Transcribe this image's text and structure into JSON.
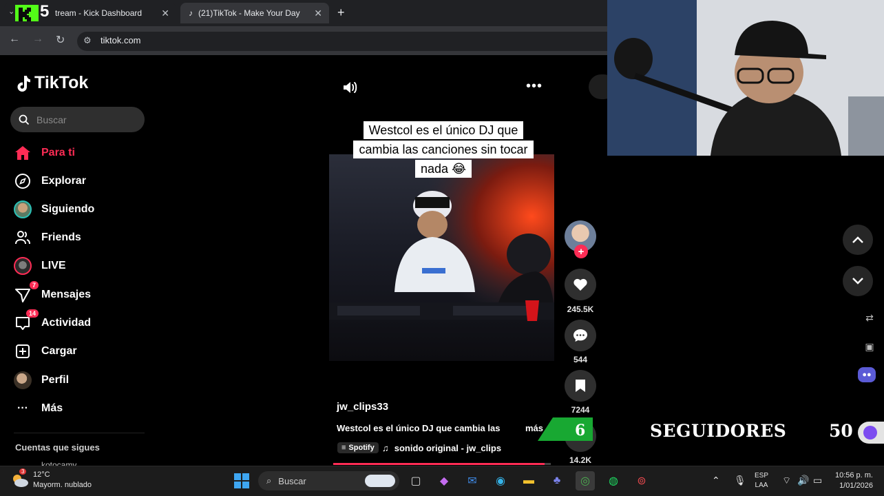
{
  "browser": {
    "tabs": [
      {
        "label": "tream - Kick Dashboard",
        "active": false
      },
      {
        "label": "(21)TikTok - Make Your Day",
        "active": true
      }
    ],
    "kick_badge": "5",
    "url": "tiktok.com"
  },
  "tiktok": {
    "brand": "TikTok",
    "search_placeholder": "Buscar",
    "nav": [
      {
        "label": "Para ti",
        "icon": "home-icon",
        "active": true
      },
      {
        "label": "Explorar",
        "icon": "compass-icon"
      },
      {
        "label": "Siguiendo",
        "icon": "following-avatar"
      },
      {
        "label": "Friends",
        "icon": "friends-icon"
      },
      {
        "label": "LIVE",
        "icon": "live-avatar"
      },
      {
        "label": "Mensajes",
        "icon": "messages-icon",
        "badge": "7"
      },
      {
        "label": "Actividad",
        "icon": "activity-icon",
        "badge": "14"
      },
      {
        "label": "Cargar",
        "icon": "upload-icon"
      },
      {
        "label": "Perfil",
        "icon": "profile-avatar"
      },
      {
        "label": "Más",
        "icon": "more-dots-icon"
      }
    ],
    "following_heading": "Cuentas que sigues",
    "following_peek": "kotocamy"
  },
  "video": {
    "caption_lines": [
      "Westcol es el único DJ que",
      "cambia las canciones sin tocar",
      "nada 😂"
    ],
    "author": "jw_clips33",
    "description": "Westcol es el único DJ que cambia las",
    "more_label": "más",
    "spotify_chip": "Spotify",
    "sound": "sonido original - jw_clips",
    "progress": 0.97,
    "likes": "245.5K",
    "comments": "544",
    "saves": "7244",
    "shares": "14.2K"
  },
  "overlay": {
    "followers_label": "SEGUIDORES",
    "followers_current": "6",
    "followers_goal": "50"
  },
  "taskbar": {
    "weather_badge": "3",
    "temperature": "12°C",
    "condition": "Mayorm. nublado",
    "search": "Buscar",
    "lang_line1": "ESP",
    "lang_line2": "LAA",
    "time": "10:56 p. m.",
    "date": "1/01/2026"
  },
  "colors": {
    "tiktok_red": "#fe2c55",
    "kick_green": "#53fc18",
    "overlay_green": "#18a832"
  }
}
